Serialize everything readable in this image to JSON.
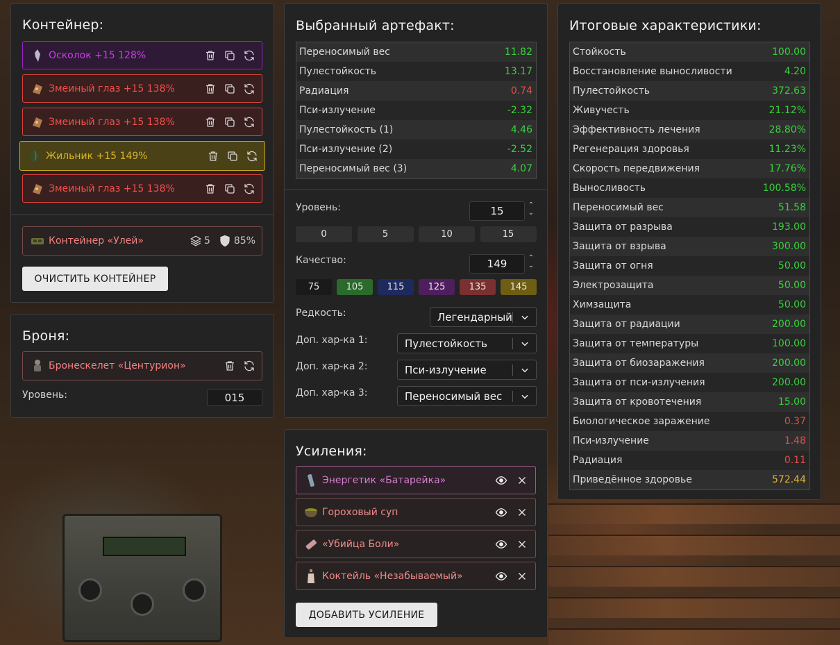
{
  "container_panel": {
    "title": "Контейнер:",
    "items": [
      {
        "label": "Осколок +15 128%",
        "icon": "shard-artifact-icon"
      },
      {
        "label": "Змеиный глаз +15 138%",
        "icon": "snake-eye-artifact-icon"
      },
      {
        "label": "Змеиный глаз +15 138%",
        "icon": "snake-eye-artifact-icon"
      },
      {
        "label": "Жильник +15 149%",
        "icon": "zhilnik-artifact-icon"
      },
      {
        "label": "Змеиный глаз +15 138%",
        "icon": "snake-eye-artifact-icon"
      }
    ],
    "container": {
      "label": "Контейнер «Улей»",
      "slots": "5",
      "protection": "85%"
    },
    "clear_button": "ОЧИСТИТЬ КОНТЕЙНЕР"
  },
  "armor_panel": {
    "title": "Броня:",
    "armor_label": "Бронескелет «Центурион»",
    "level_label": "Уровень:",
    "level_value": "015"
  },
  "artifact_panel": {
    "title": "Выбранный артефакт:",
    "stats": [
      {
        "name": "Переносимый вес",
        "value": "11.82",
        "tone": "green"
      },
      {
        "name": "Пулестойкость",
        "value": "13.17",
        "tone": "green"
      },
      {
        "name": "Радиация",
        "value": "0.74",
        "tone": "red"
      },
      {
        "name": "Пси-излучение",
        "value": "-2.32",
        "tone": "green"
      },
      {
        "name": "Пулестойкость (1)",
        "value": "4.46",
        "tone": "green"
      },
      {
        "name": "Пси-излучение (2)",
        "value": "-2.52",
        "tone": "green"
      },
      {
        "name": "Переносимый вес (3)",
        "value": "4.07",
        "tone": "green"
      }
    ],
    "level_label": "Уровень:",
    "level_value": "15",
    "level_presets": [
      "0",
      "5",
      "10",
      "15"
    ],
    "quality_label": "Качество:",
    "quality_value": "149",
    "quality_presets": [
      {
        "value": "75",
        "color": "#1a1a1a"
      },
      {
        "value": "105",
        "color": "#2a6a2a"
      },
      {
        "value": "115",
        "color": "#1e2a5e"
      },
      {
        "value": "125",
        "color": "#4e1e5e"
      },
      {
        "value": "135",
        "color": "#7a3030"
      },
      {
        "value": "145",
        "color": "#6e5e14"
      }
    ],
    "rarity_label": "Редкость:",
    "rarity_value": "Легендарный",
    "extra1_label": "Доп. хар-ка 1:",
    "extra1_value": "Пулестойкость",
    "extra2_label": "Доп. хар-ка 2:",
    "extra2_value": "Пси-излучение",
    "extra3_label": "Доп. хар-ка 3:",
    "extra3_value": "Переносимый вес"
  },
  "boosts_panel": {
    "title": "Усиления:",
    "items": [
      {
        "label": "Энергетик «Батарейка»",
        "icon": "energy-drink-icon"
      },
      {
        "label": "Гороховый суп",
        "icon": "pea-soup-icon"
      },
      {
        "label": "«Убийца Боли»",
        "icon": "painkiller-icon"
      },
      {
        "label": "Коктейль «Незабываемый»",
        "icon": "cocktail-icon"
      }
    ],
    "add_button": "ДОБАВИТЬ УСИЛЕНИЕ"
  },
  "totals_panel": {
    "title": "Итоговые характеристики:",
    "stats": [
      {
        "name": "Стойкость",
        "value": "100.00",
        "tone": "green"
      },
      {
        "name": "Восстановление выносливости",
        "value": "4.20",
        "tone": "green"
      },
      {
        "name": "Пулестойкость",
        "value": "372.63",
        "tone": "green"
      },
      {
        "name": "Живучесть",
        "value": "21.12%",
        "tone": "green"
      },
      {
        "name": "Эффективность лечения",
        "value": "28.80%",
        "tone": "green"
      },
      {
        "name": "Регенерация здоровья",
        "value": "11.23%",
        "tone": "green"
      },
      {
        "name": "Скорость передвижения",
        "value": "17.76%",
        "tone": "green"
      },
      {
        "name": "Выносливость",
        "value": "100.58%",
        "tone": "green"
      },
      {
        "name": "Переносимый вес",
        "value": "51.58",
        "tone": "green"
      },
      {
        "name": "Защита от разрыва",
        "value": "193.00",
        "tone": "green"
      },
      {
        "name": "Защита от взрыва",
        "value": "300.00",
        "tone": "green"
      },
      {
        "name": "Защита от огня",
        "value": "50.00",
        "tone": "green"
      },
      {
        "name": "Электрозащита",
        "value": "50.00",
        "tone": "green"
      },
      {
        "name": "Химзащита",
        "value": "50.00",
        "tone": "green"
      },
      {
        "name": "Защита от радиации",
        "value": "200.00",
        "tone": "green"
      },
      {
        "name": "Защита от температуры",
        "value": "100.00",
        "tone": "green"
      },
      {
        "name": "Защита от биозаражения",
        "value": "200.00",
        "tone": "green"
      },
      {
        "name": "Защита от пси-излучения",
        "value": "200.00",
        "tone": "green"
      },
      {
        "name": "Защита от кровотечения",
        "value": "15.00",
        "tone": "green"
      },
      {
        "name": "Биологическое заражение",
        "value": "0.37",
        "tone": "red"
      },
      {
        "name": "Пси-излучение",
        "value": "1.48",
        "tone": "red"
      },
      {
        "name": "Радиация",
        "value": "0.11",
        "tone": "red"
      },
      {
        "name": "Приведённое здоровье",
        "value": "572.44",
        "tone": "gold"
      }
    ]
  }
}
